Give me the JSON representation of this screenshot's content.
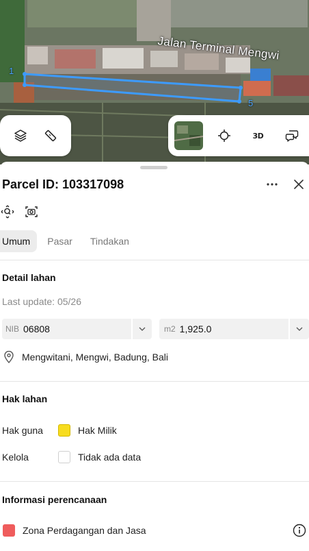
{
  "map": {
    "road_label": "Jalan Terminal Mengwi",
    "vertex_labels": [
      "1",
      "5"
    ],
    "controls": {
      "layers_icon": "layers-icon",
      "measure_icon": "ruler-icon",
      "locate_icon": "crosshair-icon",
      "three_d_label": "3D",
      "feedback_icon": "chat-icon"
    }
  },
  "sheet": {
    "title": "Parcel ID: 103317098",
    "tabs": [
      {
        "label": "Umum",
        "active": true
      },
      {
        "label": "Pasar",
        "active": false
      },
      {
        "label": "Tindakan",
        "active": false
      }
    ],
    "detail": {
      "heading": "Detail lahan",
      "last_update": "Last update: 05/26",
      "nib_prefix": "NIB",
      "nib_value": "06808",
      "area_prefix": "m2",
      "area_value": "1,925.0",
      "location": "Mengwitani, Mengwi, Badung, Bali"
    },
    "rights": {
      "heading": "Hak lahan",
      "rows": [
        {
          "label": "Hak guna",
          "value": "Hak Milik",
          "color": "#f7dc1f"
        },
        {
          "label": "Kelola",
          "value": "Tidak ada data",
          "color": "#ffffff"
        }
      ]
    },
    "planning": {
      "heading": "Informasi perencanaan",
      "zone": "Zona Perdagangan dan Jasa",
      "zone_color": "#ef5c5c"
    }
  }
}
